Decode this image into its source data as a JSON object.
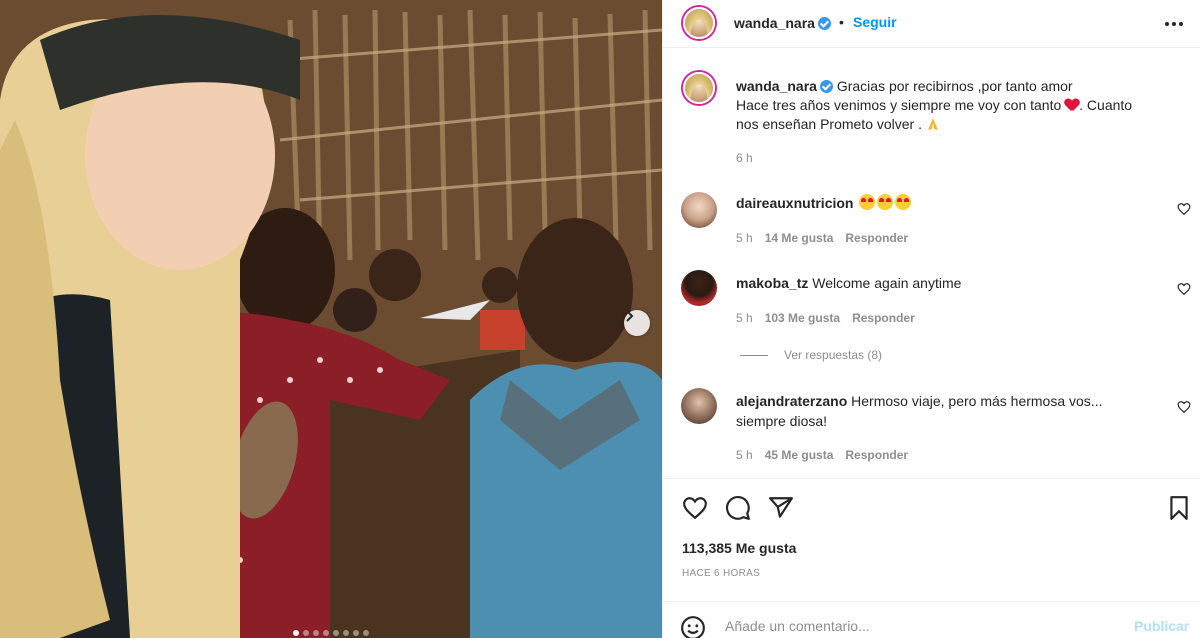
{
  "post": {
    "username": "wanda_nara",
    "separator": "•",
    "follow_label": "Seguir",
    "caption_line1": "Gracias por recibirnos ,por tanto amor",
    "caption_line2a": "Hace tres años venimos y siempre me voy con tanto",
    "caption_line2b": ". Cuanto",
    "caption_line3": "nos enseñan Prometo volver .",
    "caption_time": "6 h"
  },
  "comments": [
    {
      "username": "daireauxnutricion",
      "text": "",
      "time": "5 h",
      "likes": "14 Me gusta",
      "reply_label": "Responder"
    },
    {
      "username": "makoba_tz",
      "text": "Welcome again anytime",
      "time": "5 h",
      "likes": "103 Me gusta",
      "reply_label": "Responder"
    },
    {
      "username": "alejandraterzano",
      "text": "Hermoso viaje, pero más hermosa vos... siempre diosa!",
      "time": "5 h",
      "likes": "45 Me gusta",
      "reply_label": "Responder"
    }
  ],
  "view_replies": "Ver respuestas (8)",
  "footer": {
    "likes": "113,385 Me gusta",
    "ago": "HACE 6 HORAS",
    "comment_placeholder": "Añade un comentario...",
    "publish_label": "Publicar"
  },
  "icons": {
    "like": "heart-outline-icon",
    "comment": "speech-bubble-icon",
    "share": "paper-plane-icon",
    "save": "bookmark-icon",
    "next": "chevron-right-icon",
    "more": "ellipsis-icon"
  },
  "carousel": {
    "slides": 8,
    "active_index": 0
  },
  "colors": {
    "link_blue": "#0095f6",
    "verified": "#3897f0",
    "muted": "#8e8e8e",
    "publish_disabled": "#b2dffc"
  }
}
